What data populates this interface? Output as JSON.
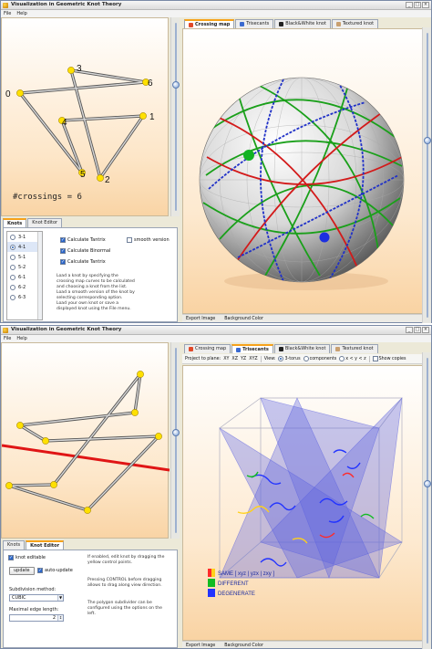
{
  "app": {
    "title": "Visualization in Geometric Knot Theory"
  },
  "menu": {
    "file": "File",
    "help": "Help"
  },
  "top": {
    "crossings_label": "#crossings = 6",
    "vertex_labels": [
      "0",
      "1",
      "2",
      "3",
      "4",
      "5",
      "6"
    ],
    "left_tabs": [
      "Knots",
      "Knot Editor"
    ],
    "knot_list": [
      "3-1",
      "4-1",
      "5-1",
      "5-2",
      "6-1",
      "6-2",
      "6-3"
    ],
    "selected_knot": "4-1",
    "options": [
      {
        "label": "Calculate Tantrix",
        "checked": true
      },
      {
        "label": "Calculate Binormal",
        "checked": true
      },
      {
        "label": "Calculate Tantrix",
        "checked": true
      },
      {
        "label": "smooth version",
        "checked": false
      }
    ],
    "help_text_1": "Load a knot by specifying the crossing map curves to be calculated and choosing a knot from the list. Load a smooth version of the knot by selecting corresponding option.",
    "help_text_2": "Load your own knot or save a displayed knot using the File menu.",
    "view_tabs": [
      "Crossing map",
      "Trisecants",
      "Black&White knot",
      "Textured knot"
    ],
    "active_view_tab": "Crossing map",
    "status": [
      "Export Image",
      "Background Color"
    ]
  },
  "bottom": {
    "left_tabs": [
      "Knots",
      "Knot Editor"
    ],
    "active_left_tab": "Knot Editor",
    "knot_editable_label": "knot editable",
    "update_button": "update",
    "auto_update_label": "auto-update",
    "subdivision_label": "Subdivision method:",
    "subdivision_value": "CUBIC",
    "max_edge_label": "Maximal edge length:",
    "max_edge_value": "2",
    "editor_help": [
      "If enabled, edit knot by dragging the yellow control points.",
      "Pressing CONTROL before dragging allows to drag along view direction.",
      "The polygon subdivider can be configured using the options on the left."
    ],
    "view_tabs": [
      "Crossing map",
      "Trisecants",
      "Black&White knot",
      "Textured knot"
    ],
    "active_view_tab": "Trisecants",
    "toolbar": {
      "project_label": "Project to plane:",
      "planes": [
        "XY",
        "XZ",
        "YZ",
        "XYZ"
      ],
      "view_label": "View:",
      "torus_label": "3-torus",
      "components_label": "components",
      "order_label": "x < y < z",
      "show_copies_label": "Show copies"
    },
    "legend": [
      {
        "label": "SAME [ xyz | yzx | zxy ]",
        "colors": [
          "#ff2a2a",
          "#ffd11a"
        ]
      },
      {
        "label": "DIFFERENT",
        "colors": [
          "#11bb22"
        ]
      },
      {
        "label": "DEGENERATE",
        "colors": [
          "#2233ff"
        ]
      }
    ],
    "status": [
      "Export Image",
      "Background Color"
    ]
  },
  "colors": {
    "knot_tube": "#9a9a9a",
    "control_point": "#ffe000",
    "red_axis": "#e01515",
    "tab_accent": "#f6a21a"
  }
}
